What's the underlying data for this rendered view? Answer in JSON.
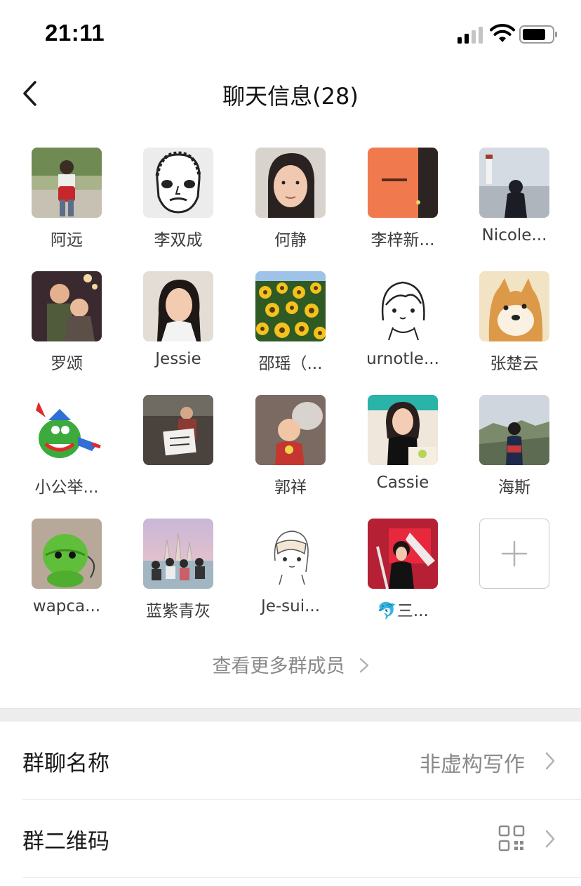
{
  "status": {
    "time": "21:11"
  },
  "nav": {
    "title": "聊天信息(28)"
  },
  "members": [
    {
      "name": "阿远"
    },
    {
      "name": "李双成"
    },
    {
      "name": "何静"
    },
    {
      "name": "李梓新..."
    },
    {
      "name": "Nicole..."
    },
    {
      "name": "罗颂"
    },
    {
      "name": "Jessie"
    },
    {
      "name": "邵瑶（..."
    },
    {
      "name": "urnotle..."
    },
    {
      "name": "张楚云"
    },
    {
      "name": "小公举..."
    },
    {
      "name": ""
    },
    {
      "name": "郭祥"
    },
    {
      "name": "Cassie"
    },
    {
      "name": "海斯"
    },
    {
      "name": "wapca..."
    },
    {
      "name": "蓝紫青灰"
    },
    {
      "name": "Je-sui..."
    },
    {
      "name": "🐬三..."
    }
  ],
  "add_member_icon": "plus-icon",
  "more_members": {
    "label": "查看更多群成员"
  },
  "settings": {
    "group_name": {
      "label": "群聊名称",
      "value": "非虚构写作"
    },
    "group_qr": {
      "label": "群二维码",
      "icon": "qr-code-icon"
    }
  }
}
